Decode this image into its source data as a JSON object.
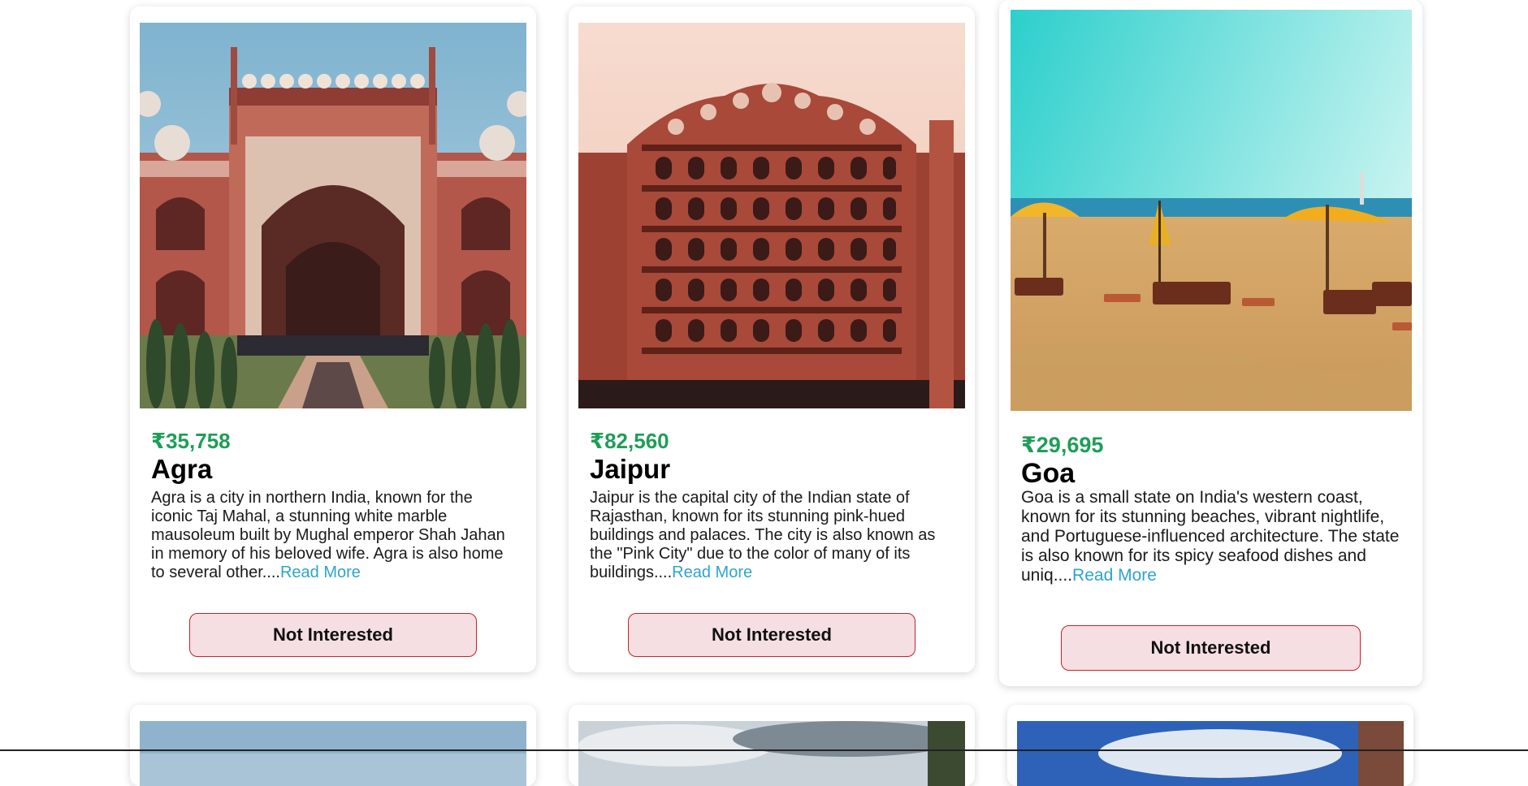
{
  "cards": [
    {
      "price": "₹35,758",
      "city": "Agra",
      "desc": "Agra is a city in northern India, known for the iconic Taj Mahal, a stunning white marble mausoleum built by Mughal emperor Shah Jahan in memory of his beloved wife. Agra is also home to several other....",
      "read_more": "Read More",
      "button": "Not Interested"
    },
    {
      "price": "₹82,560",
      "city": "Jaipur",
      "desc": "Jaipur is the capital city of the Indian state of Rajasthan, known for its stunning pink-hued buildings and palaces. The city is also known as the \"Pink City\" due to the color of many of its buildings....",
      "read_more": "Read More",
      "button": "Not Interested"
    },
    {
      "price": "₹29,695",
      "city": "Goa",
      "desc": "Goa is a small state on India's western coast, known for its stunning beaches, vibrant nightlife, and Portuguese-influenced architecture. The state is also known for its spicy seafood dishes and uniq....",
      "read_more": "Read More",
      "button": "Not Interested"
    }
  ],
  "colors": {
    "price": "#1e9e57",
    "link": "#2ea3cf",
    "button_bg": "#f6dfe2",
    "button_border": "#c8202c"
  }
}
